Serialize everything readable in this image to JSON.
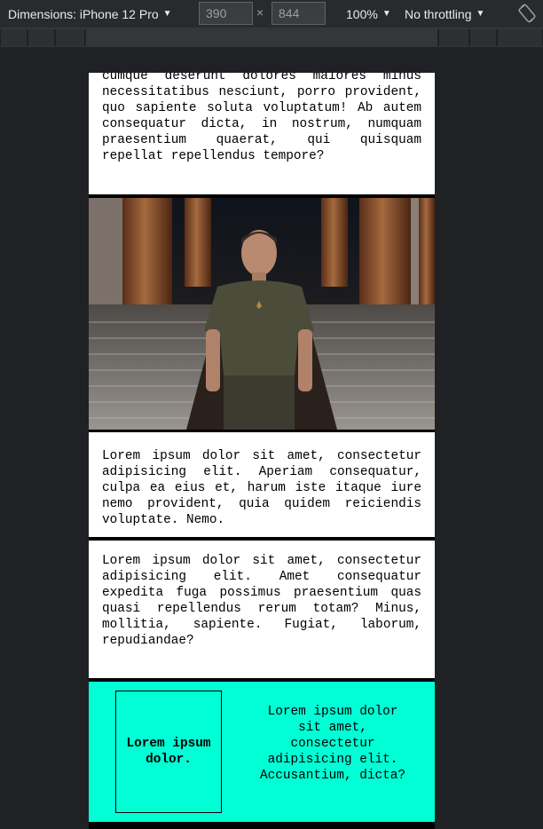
{
  "devtools": {
    "dimensions_label": "Dimensions: iPhone 12 Pro",
    "width_value": "390",
    "height_value": "844",
    "times": "×",
    "zoom": "100%",
    "throttling": "No throttling",
    "caret": "▼"
  },
  "page": {
    "card1_text": "cumque deserunt dolores maiores minus necessitatibus nesciunt, porro provident, quo sapiente soluta voluptatum! Ab autem consequatur dicta, in nostrum, numquam praesentium quaerat, qui quisquam repellat repellendus tempore?",
    "card2_text": "Lorem ipsum dolor sit amet, consectetur adipisicing elit. Aperiam consequatur, culpa ea eius et, harum iste itaque iure nemo provident, quia quidem reiciendis voluptate. Nemo.",
    "card3_text": "Lorem ipsum dolor sit amet, consectetur adipisicing elit. Amet consequatur expedita fuga possimus praesentium quas quasi repellendus rerum totam? Minus, mollitia, sapiente. Fugiat, laborum, repudiandae?",
    "feature_box_text": "Lorem ipsum dolor.",
    "feature_text": "Lorem ipsum dolor sit amet, consectetur adipisicing elit. Accusantium, dicta?",
    "feature_color": "#00ffd5"
  }
}
